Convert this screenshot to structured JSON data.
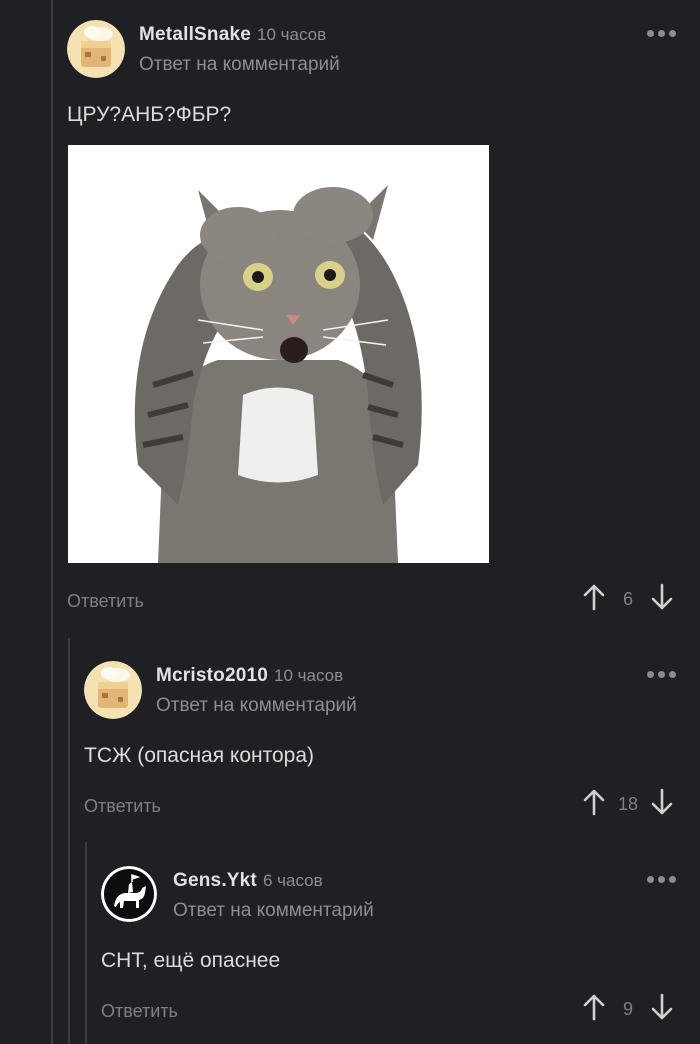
{
  "comments": [
    {
      "author": "MetallSnake",
      "time": "10 часов",
      "reply_to": "Ответ на комментарий",
      "text": "ЦРУ?АНБ?ФБР?",
      "reply_label": "Ответить",
      "votes": "6",
      "avatar": "cake-avatar",
      "image": "scared-cat-image"
    },
    {
      "author": "Mcristo2010",
      "time": "10 часов",
      "reply_to": "Ответ на комментарий",
      "text": "ТСЖ (опасная контора)",
      "reply_label": "Ответить",
      "votes": "18",
      "avatar": "cake-avatar"
    },
    {
      "author": "Gens.Ykt",
      "time": "6 часов",
      "reply_to": "Ответ на комментарий",
      "text": "СНТ, ещё опаснее",
      "reply_label": "Ответить",
      "votes": "9",
      "avatar": "horse-rider-avatar"
    }
  ],
  "colors": {
    "background": "#1e2024",
    "text": "#dcdcdc",
    "muted": "#8c8e92",
    "thread_line": "#3a3c40"
  }
}
